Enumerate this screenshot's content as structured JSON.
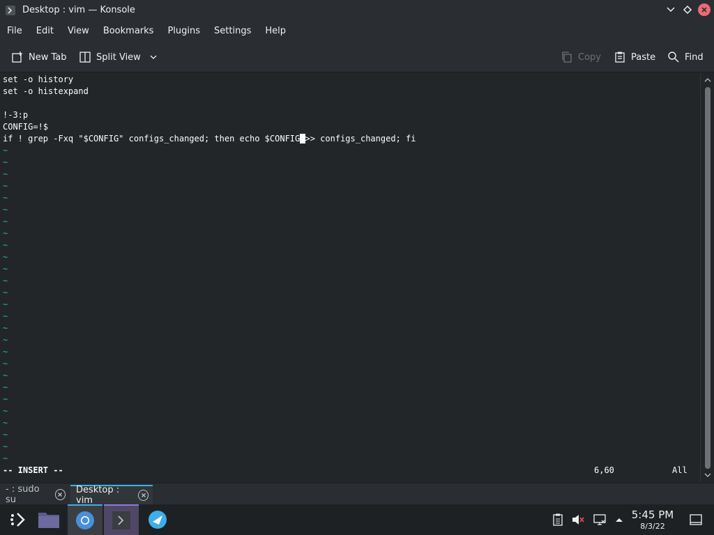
{
  "window": {
    "title": "Desktop : vim — Konsole"
  },
  "menubar": {
    "items": [
      "File",
      "Edit",
      "View",
      "Bookmarks",
      "Plugins",
      "Settings",
      "Help"
    ]
  },
  "toolbar": {
    "new_tab": "New Tab",
    "split_view": "Split View",
    "copy": "Copy",
    "paste": "Paste",
    "find": "Find"
  },
  "terminal": {
    "lines": [
      "set -o history",
      "set -o histexpand",
      "",
      "!-3:p",
      "CONFIG=!$"
    ],
    "last_line_before_cursor": "if ! grep -Fxq \"$CONFIG\" configs_changed; then echo $CONFIG",
    "cursor_char": " ",
    "last_line_after_cursor": ">> configs_changed; fi",
    "empty_line_marker": "~",
    "mode": "-- INSERT --",
    "position": "6,60",
    "scroll": "All"
  },
  "tabs": [
    {
      "label": "- : sudo su",
      "active": false
    },
    {
      "label": "Desktop : vim",
      "active": true
    }
  ],
  "taskbar": {
    "apps": [
      "application-launcher",
      "file-manager",
      "chromium-browser",
      "konsole",
      "discover"
    ],
    "clock": {
      "time": "5:45 PM",
      "date": "8/3/22"
    }
  },
  "colors": {
    "background": "#232629",
    "chrome": "#2a2e32",
    "accent": "#3daee9",
    "tilde": "#1abc9c",
    "close_button": "#ed6a74"
  }
}
